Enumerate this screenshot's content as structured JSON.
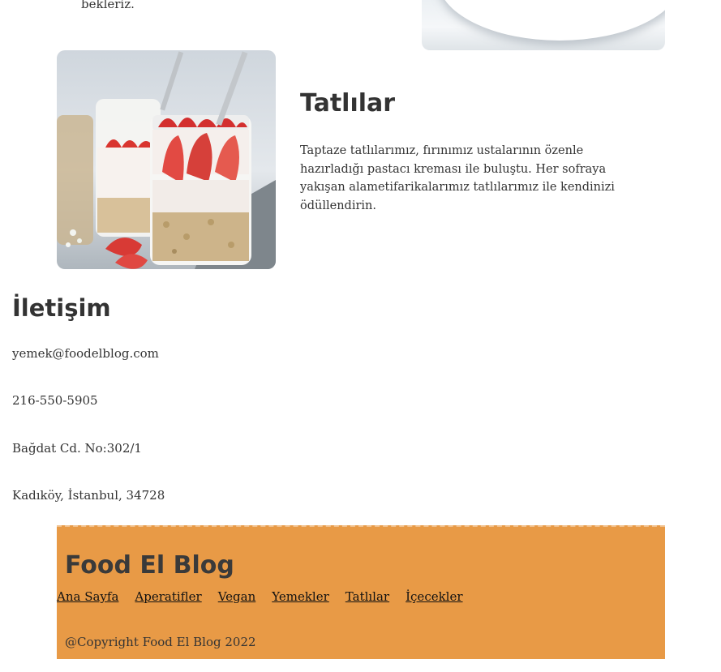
{
  "previous_section": {
    "text_fragment": "bekleriz."
  },
  "desserts": {
    "title": "Tatlılar",
    "description": "Taptaze tatlılarımız, fırınımız ustalarının özenle hazırladığı pastacı kreması ile buluştu. Her sofraya yakışan alametifarikalarımız tatlılarımız ile kendinizi ödüllendirin."
  },
  "contact": {
    "title": "İletişim",
    "email": "yemek@foodelblog.com",
    "phone": "216-550-5905",
    "address_line1": "Bağdat Cd. No:302/1",
    "address_line2": "Kadıköy, İstanbul, 34728"
  },
  "footer": {
    "title": "Food El Blog",
    "nav": [
      "Ana Sayfa",
      "Aperatifler",
      "Vegan",
      "Yemekler",
      "Tatlılar",
      "İçecekler"
    ],
    "copyright": "@Copyright Food El Blog 2022"
  },
  "colors": {
    "footer_background": "#e89a46",
    "text": "#333333"
  }
}
